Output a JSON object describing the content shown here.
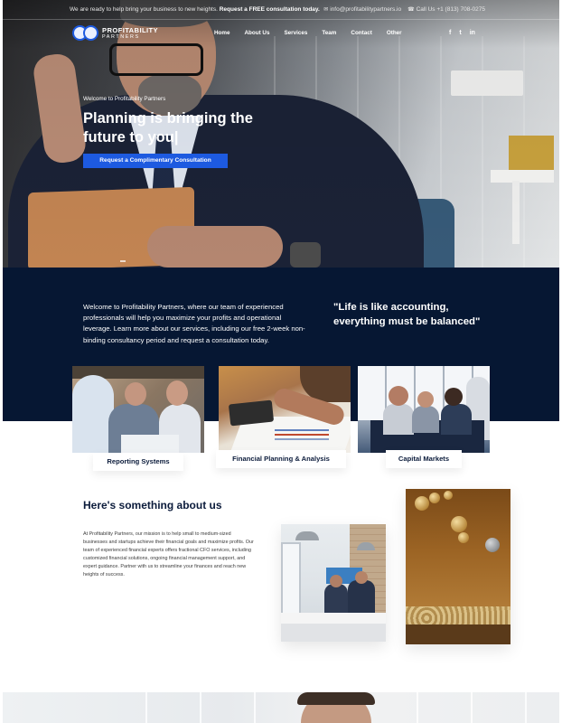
{
  "topbar": {
    "promo_text": "We are ready to help bring your business to new heights.",
    "promo_cta": "Request a FREE consultation today.",
    "email": "info@profitabilitypartners.io",
    "phone": "Call Us +1 (813) 708-0275",
    "email_icon": "envelope-icon",
    "phone_icon": "phone-icon"
  },
  "brand": {
    "name_line1": "PROFITABILITY",
    "name_line2": "PARTNERS"
  },
  "nav": {
    "items": [
      "Home",
      "About Us",
      "Services",
      "Team",
      "Contact",
      "Other"
    ]
  },
  "social": {
    "facebook": "f",
    "twitter": "t",
    "linkedin": "in"
  },
  "hero": {
    "welcome": "Welcome to Profitability Partners",
    "title": "Planning is bringing the future to you|",
    "cta": "Request a Complimentary Consultation"
  },
  "intro": {
    "text": "Welcome to Profitability Partners, where our team of experienced professionals will help you maximize your profits and operational leverage. Learn more about our services, including our free 2-week non-binding consultancy period and request a consultation today.",
    "quote": "\"Life is like accounting, everything must be balanced\""
  },
  "services": [
    {
      "label": "Reporting Systems"
    },
    {
      "label": "Financial Planning & Analysis"
    },
    {
      "label": "Capital Markets"
    }
  ],
  "about": {
    "title": "Here's something about us",
    "text": "At Profitability Partners, our mission is to help small to medium-sized businesses and startups achieve their financial goals and maximize profits. Our team of experienced financial experts offers fractional CFO services, including customized financial solutions, ongoing financial management support, and expert guidance. Partner with us to streamline your finances and reach new heights of success."
  },
  "colors": {
    "accent": "#1d5ae0",
    "navy": "#061733",
    "heading": "#0b1b3b"
  }
}
